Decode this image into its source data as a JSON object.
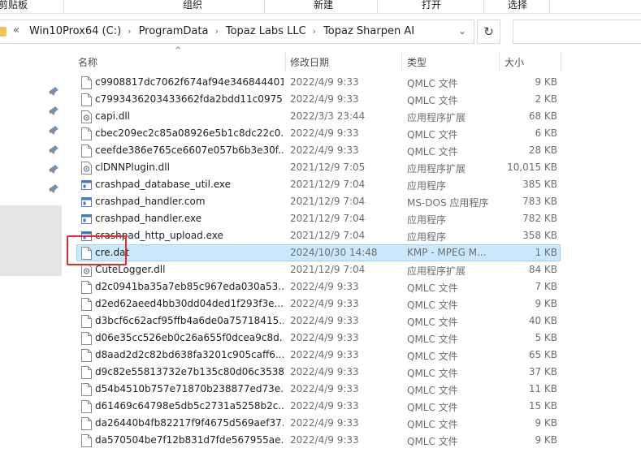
{
  "ribbon": {
    "groups": [
      "剪贴板",
      "组织",
      "新建",
      "打开",
      "选择"
    ]
  },
  "address": {
    "overflow_icon": "chevron-double-left-icon",
    "crumbs": [
      "Win10Prox64 (C:)",
      "ProgramData",
      "Topaz Labs LLC",
      "Topaz Sharpen AI"
    ],
    "dropdown_icon": "chevron-down-icon",
    "refresh_icon": "refresh-icon"
  },
  "columns": {
    "name": "名称",
    "date": "修改日期",
    "type": "类型",
    "size": "大小"
  },
  "files": [
    {
      "name": "c9908817dc7062f674af94e346844401...",
      "date": "2022/4/9 9:33",
      "type": "QMLC 文件",
      "size": "9 KB",
      "icon": "file-icon"
    },
    {
      "name": "c7993436203433662fda2bdd11c0975...",
      "date": "2022/4/9 9:33",
      "type": "QMLC 文件",
      "size": "2 KB",
      "icon": "file-icon"
    },
    {
      "name": "capi.dll",
      "date": "2022/3/3 23:44",
      "type": "应用程序扩展",
      "size": "68 KB",
      "icon": "dll-icon"
    },
    {
      "name": "cbec209ec2c85a08926e5b1c8dc22c0...",
      "date": "2022/4/9 9:33",
      "type": "QMLC 文件",
      "size": "6 KB",
      "icon": "file-icon"
    },
    {
      "name": "ceefde386e765ce6607e057b6b3e30f...",
      "date": "2022/4/9 9:33",
      "type": "QMLC 文件",
      "size": "28 KB",
      "icon": "file-icon"
    },
    {
      "name": "clDNNPlugin.dll",
      "date": "2021/12/9 7:05",
      "type": "应用程序扩展",
      "size": "10,015 KB",
      "icon": "dll-icon"
    },
    {
      "name": "crashpad_database_util.exe",
      "date": "2021/12/9 7:04",
      "type": "应用程序",
      "size": "385 KB",
      "icon": "exe-icon"
    },
    {
      "name": "crashpad_handler.com",
      "date": "2021/12/9 7:04",
      "type": "MS-DOS 应用程序",
      "size": "783 KB",
      "icon": "exe-icon"
    },
    {
      "name": "crashpad_handler.exe",
      "date": "2021/12/9 7:04",
      "type": "应用程序",
      "size": "782 KB",
      "icon": "exe-icon"
    },
    {
      "name": "crashpad_http_upload.exe",
      "date": "2021/12/9 7:04",
      "type": "应用程序",
      "size": "358 KB",
      "icon": "exe-icon"
    },
    {
      "name": "cre.dat",
      "date": "2024/10/30 14:48",
      "type": "KMP - MPEG M...",
      "size": "1 KB",
      "icon": "file-icon",
      "selected": true
    },
    {
      "name": "CuteLogger.dll",
      "date": "2021/12/9 7:04",
      "type": "应用程序扩展",
      "size": "84 KB",
      "icon": "dll-icon"
    },
    {
      "name": "d2c0941ba35a7eb85c967eda030a53...",
      "date": "2022/4/9 9:33",
      "type": "QMLC 文件",
      "size": "7 KB",
      "icon": "file-icon"
    },
    {
      "name": "d2ed62aeed4bb30dd04ded1f293f3e...",
      "date": "2022/4/9 9:33",
      "type": "QMLC 文件",
      "size": "9 KB",
      "icon": "file-icon"
    },
    {
      "name": "d3bcf6c62acf95ffb4a6de0a75718415...",
      "date": "2022/4/9 9:33",
      "type": "QMLC 文件",
      "size": "40 KB",
      "icon": "file-icon"
    },
    {
      "name": "d06e35cc526eb0c26a655f0dcea9c8d...",
      "date": "2022/4/9 9:33",
      "type": "QMLC 文件",
      "size": "5 KB",
      "icon": "file-icon"
    },
    {
      "name": "d8aad2d2c82bd638fa3201c905caff6...",
      "date": "2022/4/9 9:33",
      "type": "QMLC 文件",
      "size": "65 KB",
      "icon": "file-icon"
    },
    {
      "name": "d9c82e55813732e7b135c80d06c3538...",
      "date": "2022/4/9 9:33",
      "type": "QMLC 文件",
      "size": "37 KB",
      "icon": "file-icon"
    },
    {
      "name": "d54b4510b757e71870b238877ed73e...",
      "date": "2022/4/9 9:33",
      "type": "QMLC 文件",
      "size": "11 KB",
      "icon": "file-icon"
    },
    {
      "name": "d61469c64798e5db5c2731a5258b2c...",
      "date": "2022/4/9 9:33",
      "type": "QMLC 文件",
      "size": "15 KB",
      "icon": "file-icon"
    },
    {
      "name": "da26440b4fb82217f9f4675d569aef37...",
      "date": "2022/4/9 9:33",
      "type": "QMLC 文件",
      "size": "9 KB",
      "icon": "file-icon"
    },
    {
      "name": "da570504be7f12b831d7fde567955ae...",
      "date": "2022/4/9 9:33",
      "type": "QMLC 文件",
      "size": "9 KB",
      "icon": "file-icon"
    }
  ],
  "colors": {
    "selection_fill": "#cce8ff",
    "selection_border": "#99d1ff",
    "annotation_red": "#e02b2b",
    "folder_yellow": "#f3c455"
  }
}
